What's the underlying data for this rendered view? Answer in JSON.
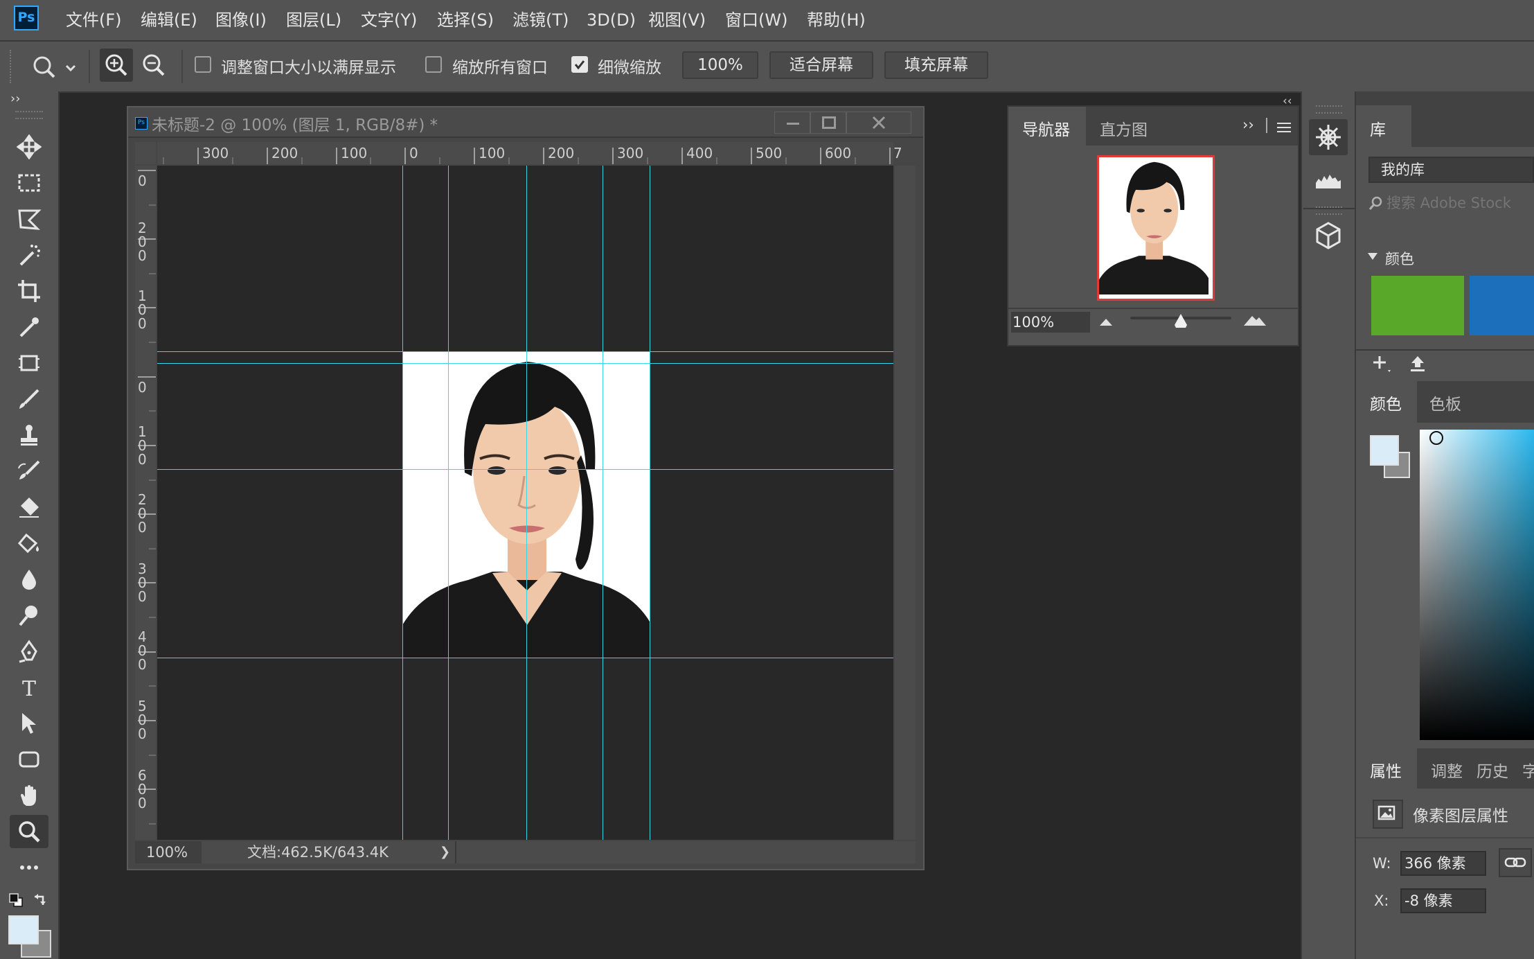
{
  "app": {
    "logo": "Ps"
  },
  "menu": [
    "文件(F)",
    "编辑(E)",
    "图像(I)",
    "图层(L)",
    "文字(Y)",
    "选择(S)",
    "滤镜(T)",
    "3D(D)",
    "视图(V)",
    "窗口(W)",
    "帮助(H)"
  ],
  "options": {
    "resize_windows": "调整窗口大小以满屏显示",
    "zoom_all": "缩放所有窗口",
    "scrubby_zoom": "细微缩放",
    "zoom_value": "100%",
    "fit_screen": "适合屏幕",
    "fill_screen": "填充屏幕",
    "checked": {
      "resize_windows": false,
      "zoom_all": false,
      "scrubby_zoom": true
    }
  },
  "toolbox": {
    "collapse": "››"
  },
  "document": {
    "title": "未标题-2 @ 100% (图层 1, RGB/8#) *",
    "ruler_h": [
      "300",
      "200",
      "100",
      "0",
      "100",
      "200",
      "300",
      "400",
      "500",
      "600",
      "7"
    ],
    "ruler_v": [
      "0",
      "200",
      "100",
      "0",
      "100",
      "200",
      "300",
      "400",
      "500",
      "600"
    ],
    "status_zoom": "100%",
    "status_doc": "文档:462.5K/643.4K",
    "status_arrow": "❯"
  },
  "navigator": {
    "tab_navigator": "导航器",
    "tab_histogram": "直方图",
    "expand": "››",
    "zoom": "100%",
    "zoom_level": 0.5
  },
  "library": {
    "tab": "库",
    "my_library": "我的库",
    "search_placeholder": "搜索 Adobe Stock",
    "colors_section": "颜色",
    "swatches": [
      "#5aa82a",
      "#1c6fba"
    ]
  },
  "color_panel": {
    "tab_color": "颜色",
    "tab_swatches": "色板",
    "foreground": "#d9ecf7",
    "background": "#8a8a8a",
    "hue": "#2bb8ee"
  },
  "properties": {
    "tab_properties": "属性",
    "tab_adjust": "调整",
    "tab_history": "历史",
    "tab_char": "字",
    "title": "像素图层属性",
    "w_label": "W:",
    "w_value": "366 像素",
    "x_label": "X:",
    "x_value": "-8 像素"
  }
}
